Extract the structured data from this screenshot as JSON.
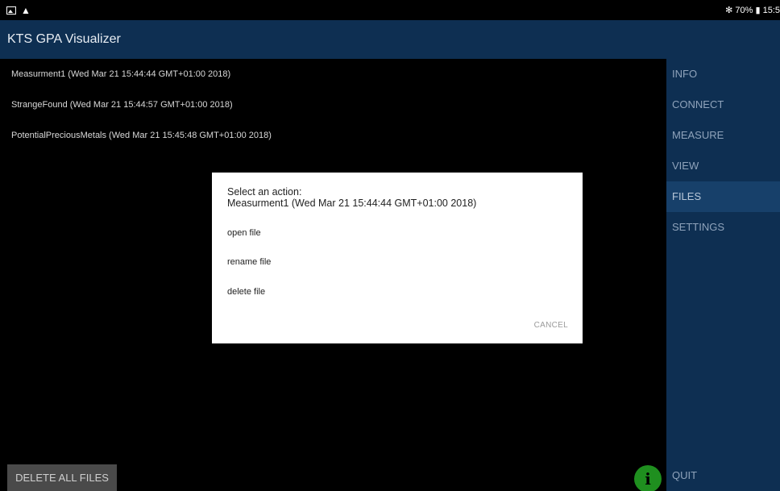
{
  "statusbar": {
    "left_icons": [
      "image-icon",
      "warning-icon"
    ],
    "right_text": "✻ 70% ▮ 15:5"
  },
  "appbar": {
    "title": "KTS GPA Visualizer"
  },
  "files": [
    "Measurment1 (Wed Mar 21 15:44:44 GMT+01:00 2018)",
    "StrangeFound (Wed Mar 21 15:44:57 GMT+01:00 2018)",
    "PotentialPreciousMetals (Wed Mar 21 15:45:48 GMT+01:00 2018)"
  ],
  "sidebar": {
    "items": [
      {
        "label": "INFO"
      },
      {
        "label": "CONNECT"
      },
      {
        "label": "MEASURE"
      },
      {
        "label": "VIEW"
      },
      {
        "label": "FILES"
      },
      {
        "label": "SETTINGS"
      }
    ],
    "active": "FILES",
    "quit_label": "QUIT"
  },
  "bottom": {
    "delete_all_label": "DELETE ALL FILES",
    "info_icon": "i"
  },
  "dialog": {
    "title_line1": "Select an action:",
    "title_line2": "Measurment1 (Wed Mar 21 15:44:44 GMT+01:00 2018)",
    "options": [
      "open file",
      "rename file",
      "delete file"
    ],
    "cancel_label": "CANCEL"
  },
  "colors": {
    "appbar": "#0e2f52",
    "sidebar_active": "#17406a",
    "fab": "#1f8f1f"
  }
}
